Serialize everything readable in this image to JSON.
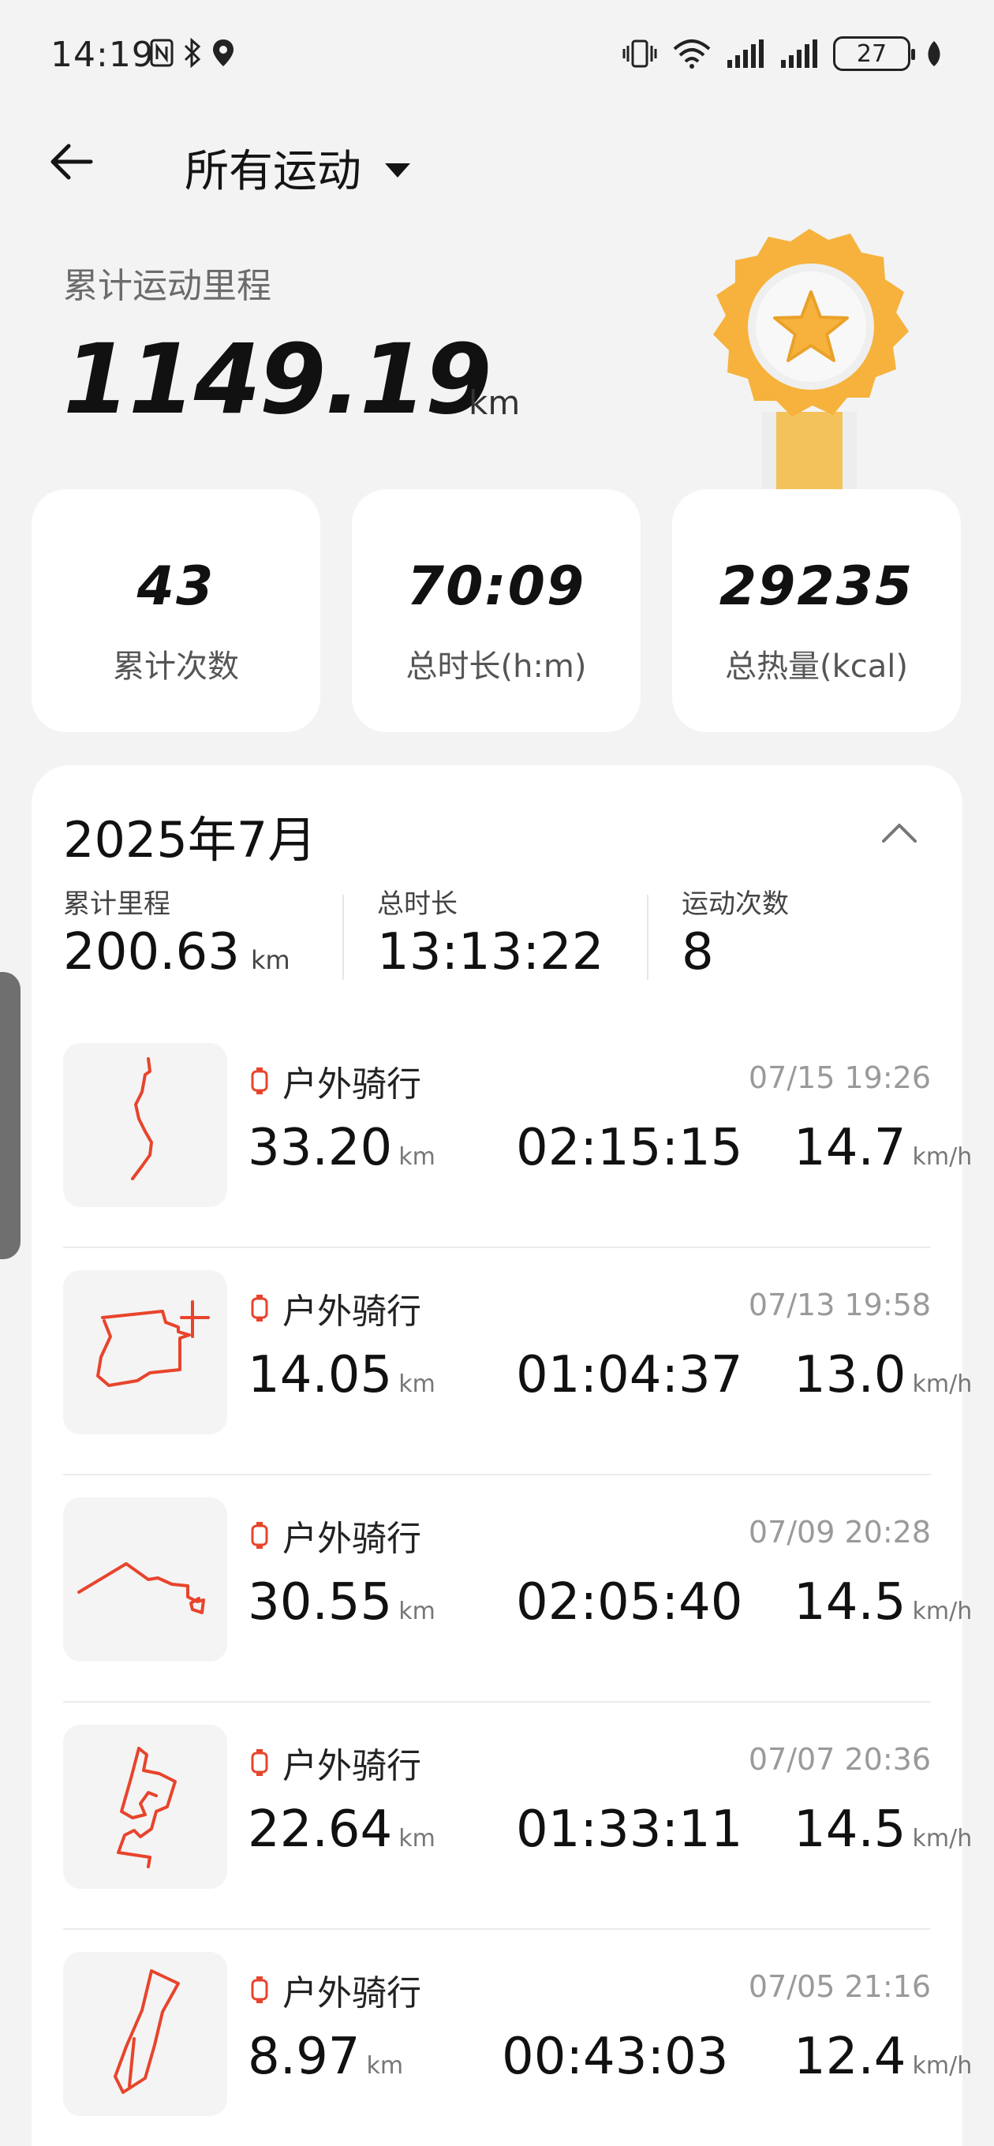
{
  "status_bar": {
    "time": "14:19",
    "battery": "27"
  },
  "header": {
    "title": "所有运动"
  },
  "total": {
    "label": "累计运动里程",
    "value": "1149.19",
    "unit": "km"
  },
  "stats": [
    {
      "value": "43",
      "label": "累计次数"
    },
    {
      "value": "70:09",
      "label": "总时长(h:m)"
    },
    {
      "value": "29235",
      "label": "总热量(kcal)"
    }
  ],
  "month": {
    "title": "2025年7月",
    "summary": {
      "distance_label": "累计里程",
      "distance_value": "200.63",
      "distance_unit": "km",
      "duration_label": "总时长",
      "duration_value": "13:13:22",
      "count_label": "运动次数",
      "count_value": "8"
    },
    "records": [
      {
        "type": "户外骑行",
        "date": "07/15 19:26",
        "distance": "33.20",
        "distance_unit": "km",
        "duration": "02:15:15",
        "speed": "14.7",
        "speed_unit": "km/h"
      },
      {
        "type": "户外骑行",
        "date": "07/13 19:58",
        "distance": "14.05",
        "distance_unit": "km",
        "duration": "01:04:37",
        "speed": "13.0",
        "speed_unit": "km/h"
      },
      {
        "type": "户外骑行",
        "date": "07/09 20:28",
        "distance": "30.55",
        "distance_unit": "km",
        "duration": "02:05:40",
        "speed": "14.5",
        "speed_unit": "km/h"
      },
      {
        "type": "户外骑行",
        "date": "07/07 20:36",
        "distance": "22.64",
        "distance_unit": "km",
        "duration": "01:33:11",
        "speed": "14.5",
        "speed_unit": "km/h"
      },
      {
        "type": "户外骑行",
        "date": "07/05 21:16",
        "distance": "8.97",
        "distance_unit": "km",
        "duration": "00:43:03",
        "speed": "12.4",
        "speed_unit": "km/h"
      }
    ]
  },
  "colors": {
    "route": "#e8442c",
    "medal": "#f6b23c",
    "background": "#f3f3f3"
  }
}
